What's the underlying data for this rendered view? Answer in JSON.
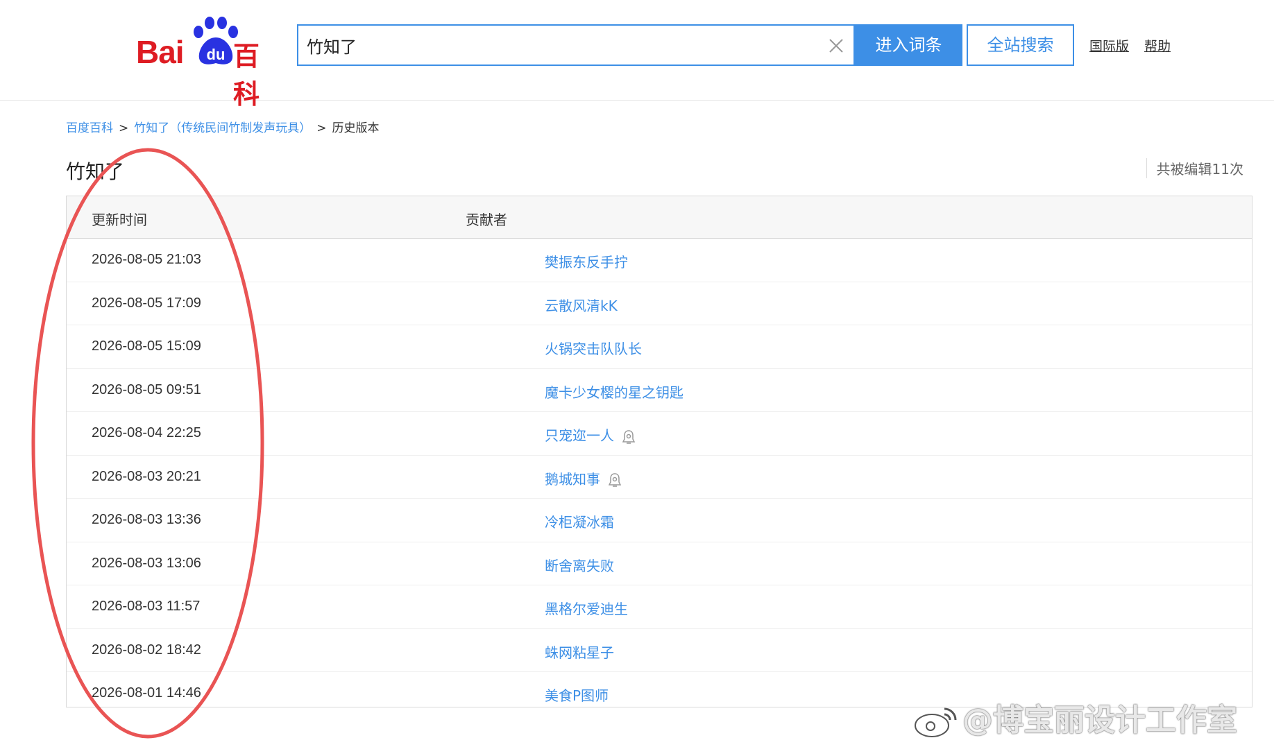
{
  "header": {
    "logo_text": "Bai du 百科",
    "logo_bai": "Bai",
    "logo_du": "du",
    "logo_baike": "百科",
    "search_value": "竹知了",
    "enter_button": "进入词条",
    "site_search_button": "全站搜索",
    "international_link": "国际版",
    "help_link": "帮助"
  },
  "breadcrumb": {
    "home": "百度百科",
    "entry": "竹知了（传统民间竹制发声玩具）",
    "current": "历史版本",
    "sep": ">"
  },
  "page": {
    "title": "竹知了",
    "edit_count": "共被编辑11次"
  },
  "table": {
    "headers": {
      "time": "更新时间",
      "contributor": "贡献者"
    },
    "rows": [
      {
        "time": "2026-08-05 21:03",
        "contributor": "樊振东反手拧",
        "badge": false
      },
      {
        "time": "2026-08-05 17:09",
        "contributor": "云散风清kK",
        "badge": false
      },
      {
        "time": "2026-08-05 15:09",
        "contributor": "火锅突击队队长",
        "badge": false
      },
      {
        "time": "2026-08-05 09:51",
        "contributor": "魔卡少女樱的星之钥匙",
        "badge": false
      },
      {
        "time": "2026-08-04 22:25",
        "contributor": "只宠迩一人",
        "badge": true
      },
      {
        "time": "2026-08-03 20:21",
        "contributor": "鹅城知事",
        "badge": true
      },
      {
        "time": "2026-08-03 13:36",
        "contributor": "冷柜凝冰霜",
        "badge": false
      },
      {
        "time": "2026-08-03 13:06",
        "contributor": "断舍离失败",
        "badge": false
      },
      {
        "time": "2026-08-03 11:57",
        "contributor": "黑格尔爱迪生",
        "badge": false
      },
      {
        "time": "2026-08-02 18:42",
        "contributor": "蛛网粘星子",
        "badge": false
      },
      {
        "time": "2026-08-01 14:46",
        "contributor": "美食P图师",
        "badge": false
      }
    ]
  },
  "watermark": "@博宝丽设计工作室",
  "colors": {
    "brand_red": "#de1c23",
    "brand_blue": "#2932e1",
    "link_blue": "#3d8fe6",
    "annotation_red": "#e95454"
  },
  "icons": [
    "baidu-paw-icon",
    "clear-icon",
    "user-badge-icon",
    "weibo-icon"
  ]
}
